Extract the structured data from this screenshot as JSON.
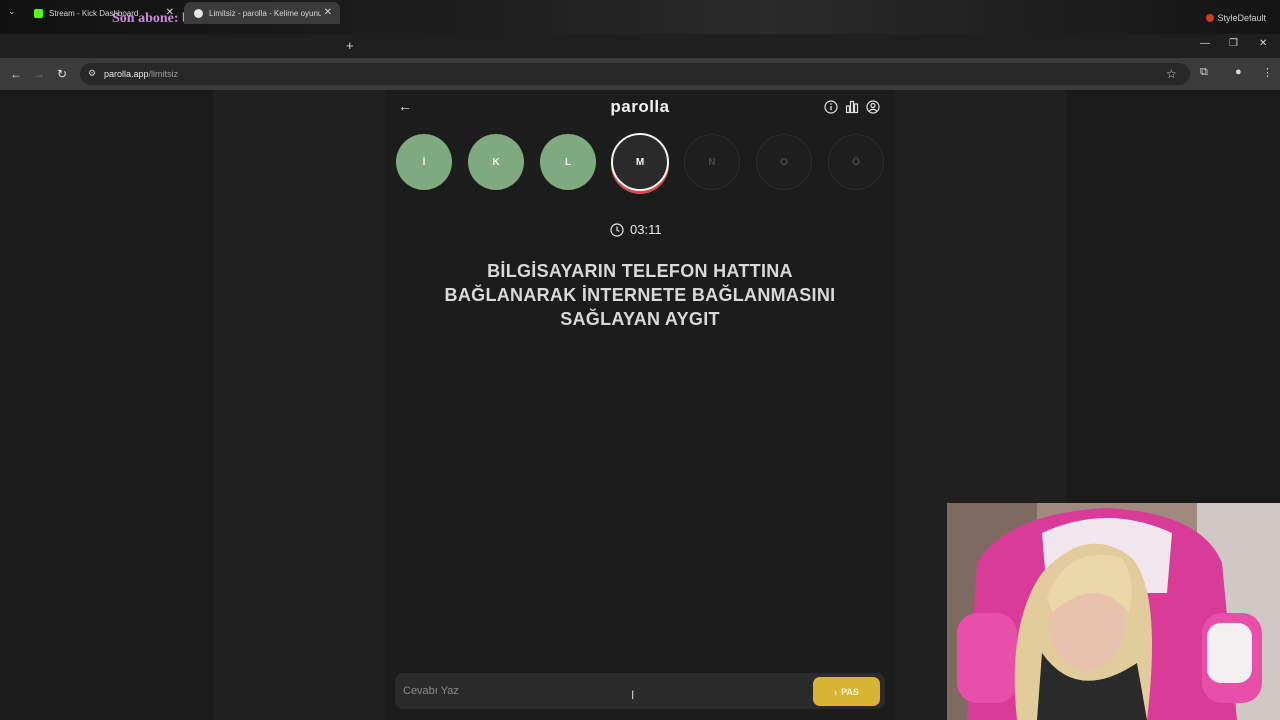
{
  "overlay": {
    "sub_banner": "Son abone: boracorleone",
    "brand": "StyleDefault"
  },
  "browser": {
    "tabs": [
      {
        "label": "Stream - Kick Dashboard",
        "active": false
      },
      {
        "label": "Limitsiz - parolla - Kelime oyunu",
        "active": true
      }
    ],
    "url_domain": "parolla.app",
    "url_path": "/limitsiz"
  },
  "app": {
    "title": "parolla",
    "letters": [
      {
        "letter": "İ",
        "state": "done"
      },
      {
        "letter": "K",
        "state": "done"
      },
      {
        "letter": "L",
        "state": "done"
      },
      {
        "letter": "M",
        "state": "active"
      },
      {
        "letter": "N",
        "state": "todo"
      },
      {
        "letter": "O",
        "state": "todo"
      },
      {
        "letter": "Ö",
        "state": "todo"
      }
    ],
    "timer": "03:11",
    "question": "BİLGİSAYARIN TELEFON HATTINA BAĞLANARAK İNTERNETE BAĞLANMASINI SAĞLAYAN AYGIT",
    "answer": {
      "placeholder": "Cevabı Yaz",
      "value": ""
    },
    "pass_label": "PAS"
  },
  "colors": {
    "done": "#7faa7f",
    "active_ring": "#f4f4f4",
    "active_underline": "#d44a4a",
    "pass": "#d9b432",
    "sub_banner": "#c88ad8"
  }
}
